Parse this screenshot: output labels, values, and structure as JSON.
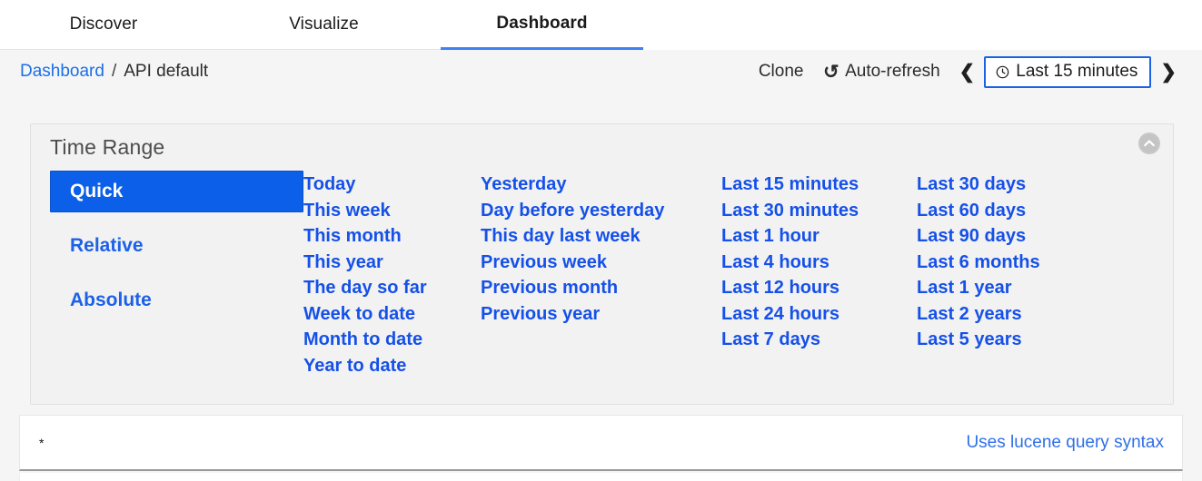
{
  "nav": {
    "tabs": [
      {
        "label": "Discover",
        "active": false
      },
      {
        "label": "Visualize",
        "active": false
      },
      {
        "label": "Dashboard",
        "active": true
      }
    ]
  },
  "toolbar": {
    "breadcrumb_root": "Dashboard",
    "breadcrumb_separator": "/",
    "breadcrumb_current": "API default",
    "clone_label": "Clone",
    "auto_refresh_label": "Auto-refresh",
    "refresh_icon": "refresh-icon",
    "prev_arrow": "❮",
    "next_arrow": "❯",
    "time_range_label": "Last 15 minutes",
    "clock_icon": "clock-icon"
  },
  "time_range_panel": {
    "title": "Time Range",
    "collapse_icon": "chevron-up-circle-icon",
    "mode_tabs": [
      {
        "label": "Quick",
        "active": true
      },
      {
        "label": "Relative",
        "active": false
      },
      {
        "label": "Absolute",
        "active": false
      }
    ],
    "columns": [
      {
        "items": [
          "Today",
          "This week",
          "This month",
          "This year",
          "The day so far",
          "Week to date",
          "Month to date",
          "Year to date"
        ]
      },
      {
        "items": [
          "Yesterday",
          "Day before yesterday",
          "This day last week",
          "Previous week",
          "Previous month",
          "Previous year"
        ]
      },
      {
        "items": [
          "Last 15 minutes",
          "Last 30 minutes",
          "Last 1 hour",
          "Last 4 hours",
          "Last 12 hours",
          "Last 24 hours",
          "Last 7 days"
        ]
      },
      {
        "items": [
          "Last 30 days",
          "Last 60 days",
          "Last 90 days",
          "Last 6 months",
          "Last 1 year",
          "Last 2 years",
          "Last 5 years"
        ]
      }
    ]
  },
  "query_bar": {
    "value": "*",
    "placeholder": "",
    "help_link": "Uses lucene query syntax"
  },
  "colors": {
    "accent_blue": "#1550e8",
    "active_fill": "#0b5fe8",
    "tab_underline": "#3b82f6",
    "panel_bg": "#f2f2f2",
    "page_bg": "#f5f5f5"
  }
}
